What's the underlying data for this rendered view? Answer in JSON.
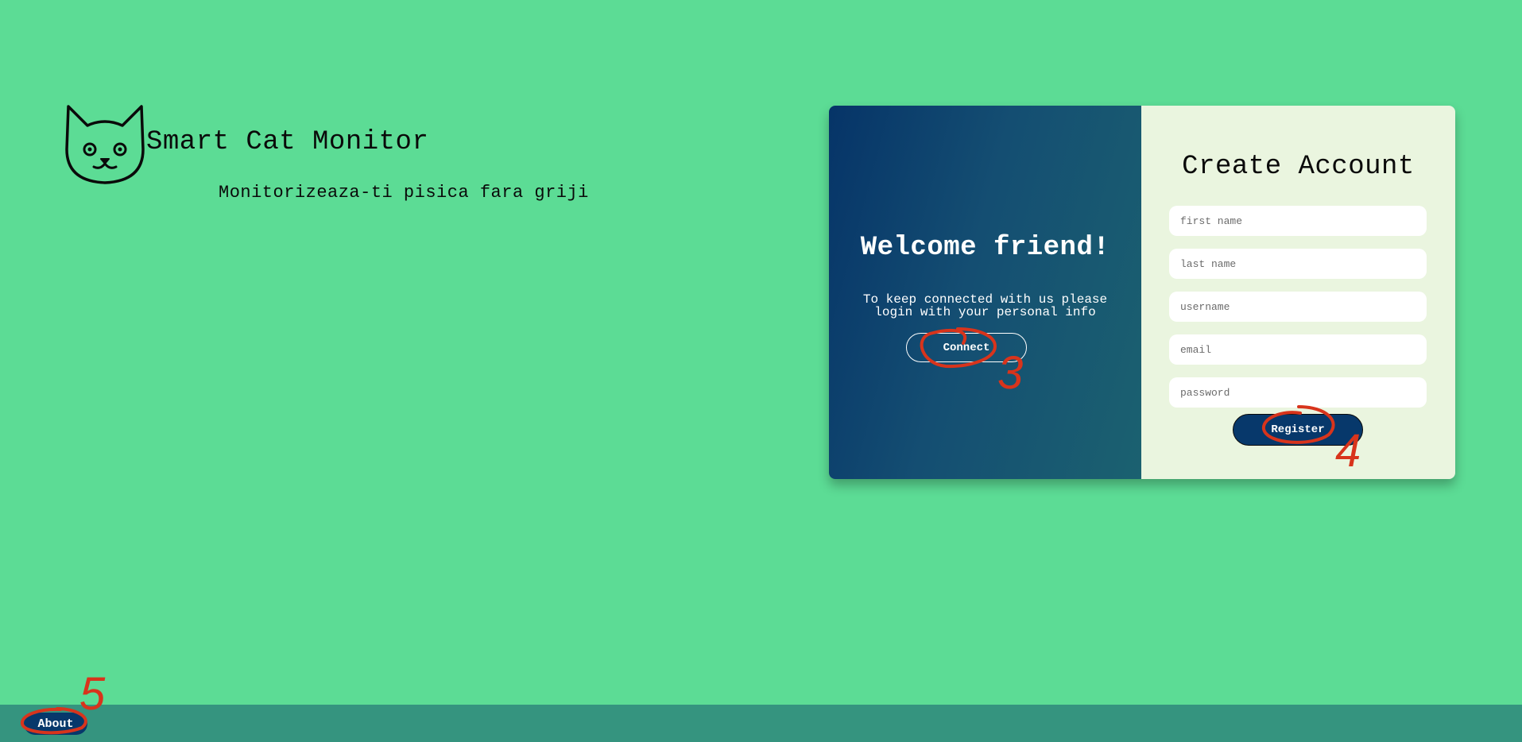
{
  "brand": {
    "title": "Smart Cat Monitor",
    "tagline": "Monitorizeaza-ti pisica fara griji",
    "logo_icon": "cat-face-icon"
  },
  "welcome": {
    "title": "Welcome friend!",
    "text": "To keep connected with us please login with your personal info",
    "connect_label": "Connect"
  },
  "register_form": {
    "title": "Create Account",
    "fields": {
      "first_name": {
        "placeholder": "first name",
        "value": ""
      },
      "last_name": {
        "placeholder": "last name",
        "value": ""
      },
      "username": {
        "placeholder": "username",
        "value": ""
      },
      "email": {
        "placeholder": "email",
        "value": ""
      },
      "password": {
        "placeholder": "password",
        "value": ""
      }
    },
    "register_label": "Register"
  },
  "footer": {
    "about_label": "About"
  },
  "annotations": {
    "markers": [
      "3",
      "4",
      "5"
    ],
    "color": "#d8341c"
  },
  "colors": {
    "background": "#5cdc95",
    "accent": "#07386b",
    "footer": "#35947f",
    "form_panel": "#eaf5df"
  }
}
